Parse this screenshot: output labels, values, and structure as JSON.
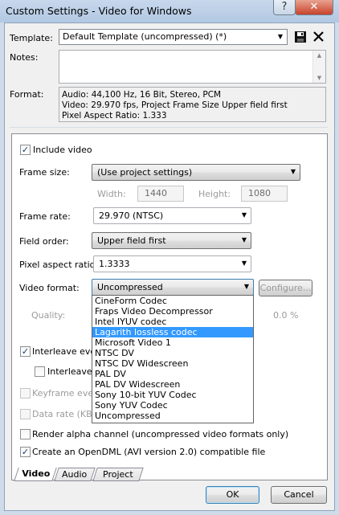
{
  "window": {
    "title": "Custom Settings - Video for Windows",
    "help_label": "?",
    "close_label": "✕"
  },
  "header": {
    "template_label": "Template:",
    "template_value": "Default Template (uncompressed) (*)",
    "notes_label": "Notes:",
    "notes_value": "",
    "format_label": "Format:",
    "format_lines": [
      "Audio: 44,100 Hz, 16 Bit, Stereo, PCM",
      "Video: 29.970 fps, Project Frame Size Upper field first",
      "Pixel Aspect Ratio: 1.333"
    ]
  },
  "video": {
    "include_video_label": "Include video",
    "include_video_checked": true,
    "frame_size_label": "Frame size:",
    "frame_size_value": "(Use project settings)",
    "width_label": "Width:",
    "width_value": "1440",
    "height_label": "Height:",
    "height_value": "1080",
    "frame_rate_label": "Frame rate:",
    "frame_rate_value": "29.970 (NTSC)",
    "field_order_label": "Field order:",
    "field_order_value": "Upper field first",
    "pixel_aspect_label": "Pixel aspect ratio:",
    "pixel_aspect_value": "1.3333",
    "video_format_label": "Video format:",
    "video_format_value": "Uncompressed",
    "configure_label": "Configure...",
    "quality_label": "Quality:",
    "quality_value": "0.0 %",
    "video_format_options": [
      "CineForm Codec",
      "Fraps Video Decompressor",
      "Intel IYUV codec",
      "Lagarith lossless codec",
      "Microsoft Video 1",
      "NTSC DV",
      "NTSC DV Widescreen",
      "PAL DV",
      "PAL DV Widescreen",
      "Sony 10-bit YUV Codec",
      "Sony YUV Codec",
      "Uncompressed"
    ],
    "highlighted_option": "Lagarith lossless codec",
    "interleave_every_label": "Interleave every",
    "interleave_every2_label": "Interleave e",
    "keyframe_label": "Keyframe every",
    "datarate_label": "Data rate (KByt",
    "render_alpha_label": "Render alpha channel (uncompressed video formats only)",
    "opendml_label": "Create an OpenDML (AVI version 2.0) compatible file"
  },
  "tabs": [
    "Video",
    "Audio",
    "Project"
  ],
  "buttons": {
    "ok": "OK",
    "cancel": "Cancel"
  }
}
